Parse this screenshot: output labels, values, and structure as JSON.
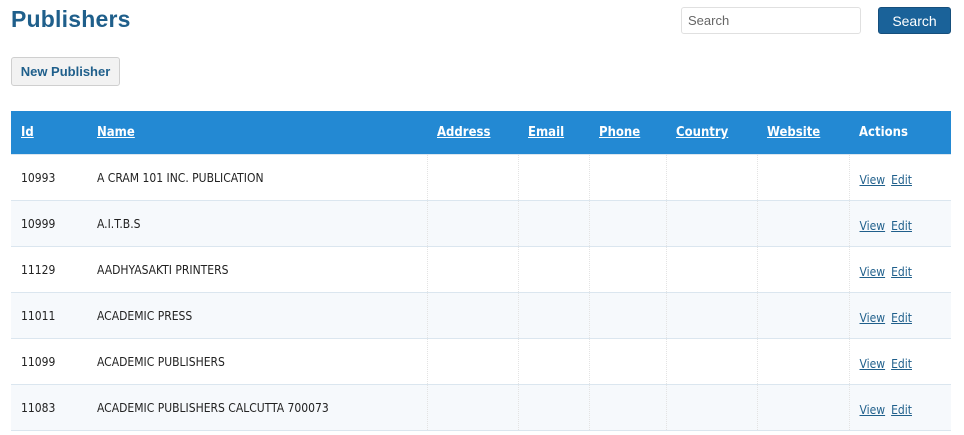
{
  "header": {
    "title": "Publishers",
    "search_placeholder": "Search",
    "search_value": "",
    "search_button_label": "Search"
  },
  "toolbar": {
    "new_button_label": "New Publisher"
  },
  "table": {
    "columns": {
      "id": "Id",
      "name": "Name",
      "address": "Address",
      "email": "Email",
      "phone": "Phone",
      "country": "Country",
      "website": "Website",
      "actions": "Actions"
    },
    "view_label": "View",
    "edit_label": "Edit",
    "rows": [
      {
        "id": "10993",
        "name": "A CRAM 101 INC. PUBLICATION",
        "address": "",
        "email": "",
        "phone": "",
        "country": "",
        "website": ""
      },
      {
        "id": "10999",
        "name": "A.I.T.B.S",
        "address": "",
        "email": "",
        "phone": "",
        "country": "",
        "website": ""
      },
      {
        "id": "11129",
        "name": "AADHYASAKTI PRINTERS",
        "address": "",
        "email": "",
        "phone": "",
        "country": "",
        "website": ""
      },
      {
        "id": "11011",
        "name": "ACADEMIC PRESS",
        "address": "",
        "email": "",
        "phone": "",
        "country": "",
        "website": ""
      },
      {
        "id": "11099",
        "name": "ACADEMIC PUBLISHERS",
        "address": "",
        "email": "",
        "phone": "",
        "country": "",
        "website": ""
      },
      {
        "id": "11083",
        "name": "ACADEMIC PUBLISHERS CALCUTTA 700073",
        "address": "",
        "email": "",
        "phone": "",
        "country": "",
        "website": ""
      }
    ]
  }
}
